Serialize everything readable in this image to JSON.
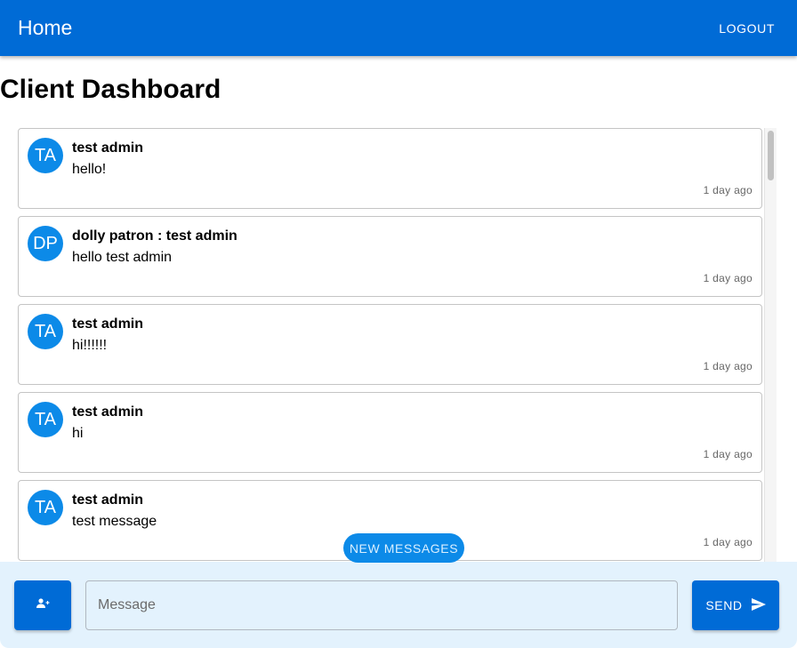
{
  "appbar": {
    "title": "Home",
    "logout_label": "LOGOUT"
  },
  "page": {
    "title": "Client Dashboard"
  },
  "messages": [
    {
      "initials": "TA",
      "sender": "test admin",
      "text": "hello!",
      "time": "1 day ago"
    },
    {
      "initials": "DP",
      "sender": "dolly patron : test admin",
      "text": "hello test admin",
      "time": "1 day ago"
    },
    {
      "initials": "TA",
      "sender": "test admin",
      "text": "hi!!!!!!",
      "time": "1 day ago"
    },
    {
      "initials": "TA",
      "sender": "test admin",
      "text": "hi",
      "time": "1 day ago"
    },
    {
      "initials": "TA",
      "sender": "test admin",
      "text": "test message",
      "time": "1 day ago"
    }
  ],
  "new_messages_label": "NEW MESSAGES",
  "composer": {
    "placeholder": "Message",
    "send_label": "SEND",
    "add_icon": "person-add-icon",
    "send_icon": "send-icon"
  },
  "colors": {
    "primary": "#006bd6",
    "avatar": "#0c8ae8",
    "composer_bg": "#e3f2fd"
  }
}
